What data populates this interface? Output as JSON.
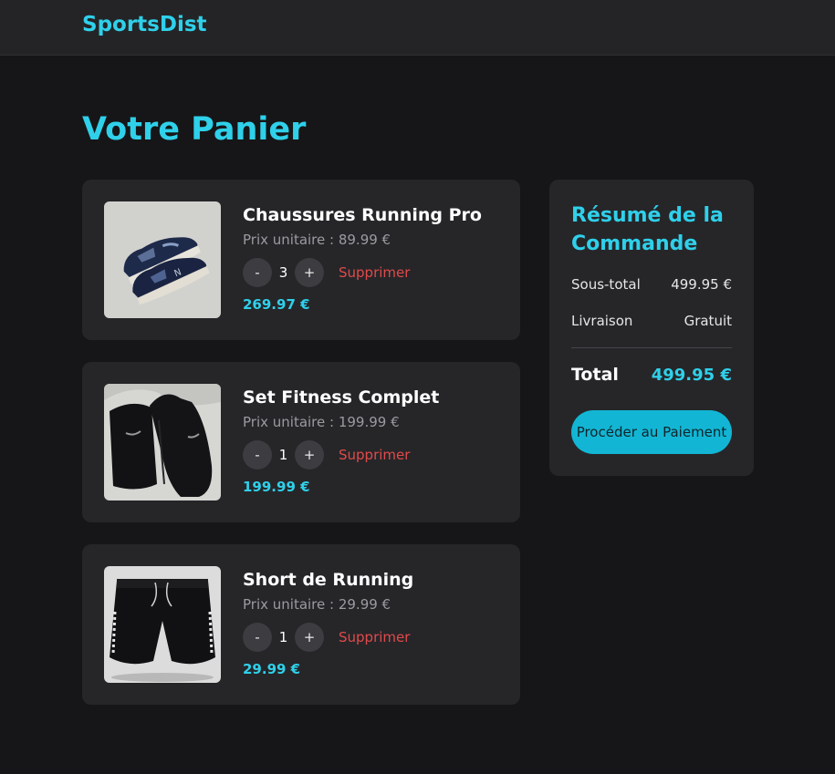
{
  "header": {
    "brand": "SportsDist"
  },
  "page": {
    "title": "Votre Panier"
  },
  "cart": {
    "items": [
      {
        "name": "Chaussures Running Pro",
        "unit_price": "Prix unitaire : 89.99 €",
        "quantity": "3",
        "minus_label": "-",
        "plus_label": "+",
        "remove_label": "Supprimer",
        "line_total": "269.97 €",
        "image_icon": "running-shoes-photo"
      },
      {
        "name": "Set Fitness Complet",
        "unit_price": "Prix unitaire : 199.99 €",
        "quantity": "1",
        "minus_label": "-",
        "plus_label": "+",
        "remove_label": "Supprimer",
        "line_total": "199.99 €",
        "image_icon": "tracksuit-photo"
      },
      {
        "name": "Short de Running",
        "unit_price": "Prix unitaire : 29.99 €",
        "quantity": "1",
        "minus_label": "-",
        "plus_label": "+",
        "remove_label": "Supprimer",
        "line_total": "29.99 €",
        "image_icon": "running-shorts-photo"
      }
    ]
  },
  "summary": {
    "title": "Résumé de la Commande",
    "subtotal_label": "Sous-total",
    "subtotal_value": "499.95 €",
    "shipping_label": "Livraison",
    "shipping_value": "Gratuit",
    "total_label": "Total",
    "total_value": "499.95 €",
    "checkout_label": "Procéder au Paiement"
  },
  "colors": {
    "background": "#161618",
    "card": "#262629",
    "accent": "#2fd0ea",
    "button": "#12b6d4",
    "danger": "#e04a4a"
  }
}
